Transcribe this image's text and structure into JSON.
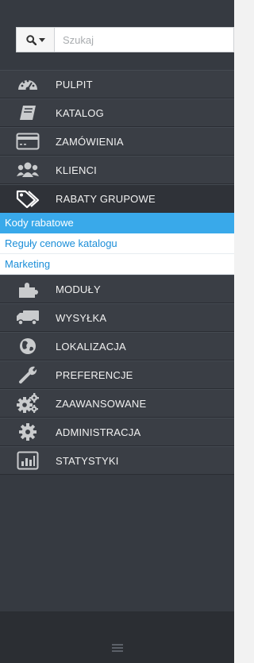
{
  "search": {
    "placeholder": "Szukaj",
    "icon": "search-icon"
  },
  "menu": {
    "items": [
      {
        "label": "PULPIT",
        "icon": "dashboard-icon"
      },
      {
        "label": "KATALOG",
        "icon": "book-icon"
      },
      {
        "label": "ZAMÓWIENIA",
        "icon": "credit-card-icon"
      },
      {
        "label": "KLIENCI",
        "icon": "users-icon"
      },
      {
        "label": "RABATY GRUPOWE",
        "icon": "tags-icon",
        "active": true
      },
      {
        "label": "MODUŁY",
        "icon": "puzzle-icon"
      },
      {
        "label": "WYSYŁKA",
        "icon": "truck-icon"
      },
      {
        "label": "LOKALIZACJA",
        "icon": "globe-icon"
      },
      {
        "label": "PREFERENCJE",
        "icon": "wrench-icon"
      },
      {
        "label": "ZAAWANSOWANE",
        "icon": "cogs-icon"
      },
      {
        "label": "ADMINISTRACJA",
        "icon": "gear-icon"
      },
      {
        "label": "STATYSTYKI",
        "icon": "bar-chart-icon"
      }
    ],
    "submenu": [
      {
        "label": "Kody rabatowe",
        "active": true
      },
      {
        "label": "Reguły cenowe katalogu"
      },
      {
        "label": "Marketing"
      }
    ]
  },
  "footer": {
    "toggle_icon": "collapse-icon"
  },
  "colors": {
    "sidebar_bg": "#363a41",
    "active_item_bg": "#2f3238",
    "submenu_active_bg": "#39a9ea",
    "link": "#1b8ed8"
  }
}
